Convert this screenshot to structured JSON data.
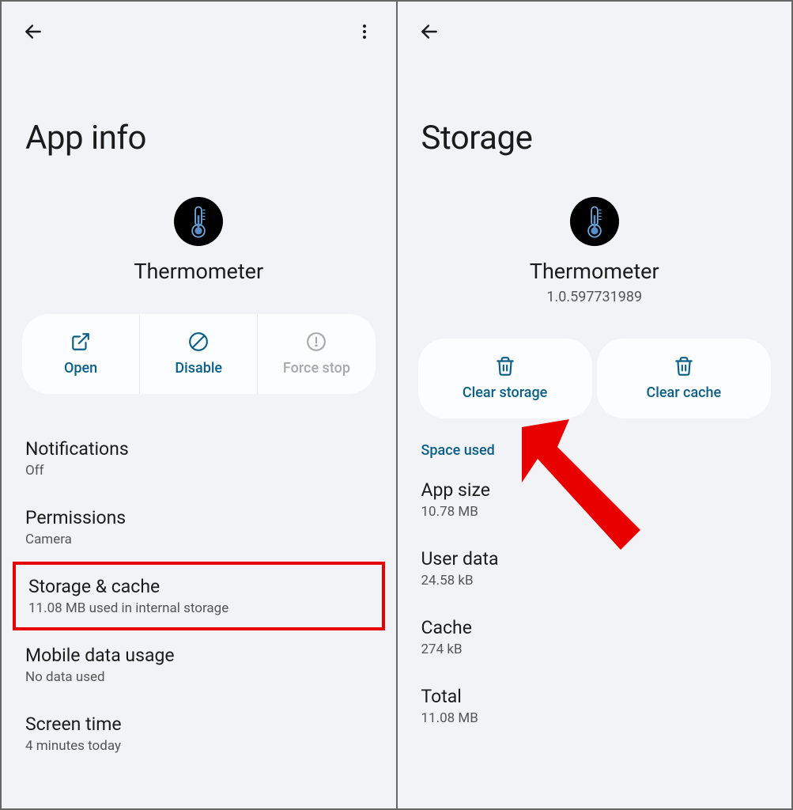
{
  "left": {
    "title": "App info",
    "app_name": "Thermometer",
    "buttons": {
      "open": "Open",
      "disable": "Disable",
      "force_stop": "Force stop"
    },
    "items": [
      {
        "title": "Notifications",
        "subtitle": "Off"
      },
      {
        "title": "Permissions",
        "subtitle": "Camera"
      },
      {
        "title": "Storage & cache",
        "subtitle": "11.08 MB used in internal storage"
      },
      {
        "title": "Mobile data usage",
        "subtitle": "No data used"
      },
      {
        "title": "Screen time",
        "subtitle": "4 minutes today"
      }
    ]
  },
  "right": {
    "title": "Storage",
    "app_name": "Thermometer",
    "app_version": "1.0.597731989",
    "buttons": {
      "clear_storage": "Clear storage",
      "clear_cache": "Clear cache"
    },
    "section": "Space used",
    "info": [
      {
        "label": "App size",
        "value": "10.78 MB"
      },
      {
        "label": "User data",
        "value": "24.58 kB"
      },
      {
        "label": "Cache",
        "value": "274 kB"
      },
      {
        "label": "Total",
        "value": "11.08 MB"
      }
    ]
  }
}
